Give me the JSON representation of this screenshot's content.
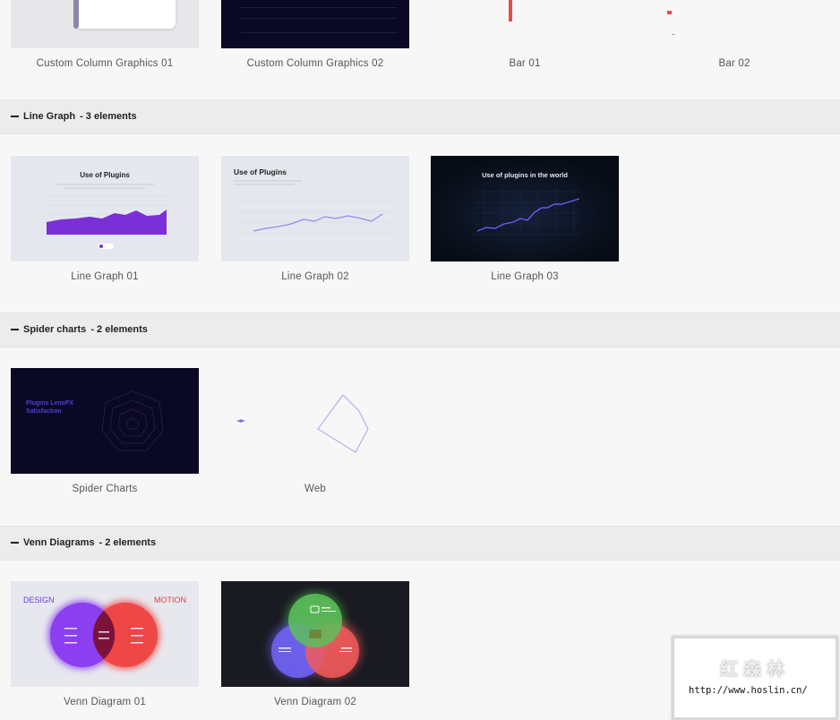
{
  "top_row": {
    "items": [
      {
        "caption": "Custom Column Graphics 01"
      },
      {
        "caption": "Custom Column Graphics 02"
      },
      {
        "caption": "Bar 01"
      },
      {
        "caption": "Bar 02"
      }
    ]
  },
  "sections": [
    {
      "title": "Line Graph",
      "count": "- 3 elements",
      "items": [
        {
          "caption": "Line Graph 01",
          "thumb_title": "Use of Plugins"
        },
        {
          "caption": "Line Graph 02",
          "thumb_title": "Use of Plugins"
        },
        {
          "caption": "Line Graph 03",
          "thumb_title": "Use of plugins in the world"
        }
      ]
    },
    {
      "title": "Spider charts",
      "count": "- 2 elements",
      "items": [
        {
          "caption": "Spider Charts",
          "thumb_title_1": "Plugins LenoFX",
          "thumb_title_2": "Satisfaction"
        },
        {
          "caption": "Web"
        }
      ]
    },
    {
      "title": "Venn Diagrams",
      "count": "- 2 elements",
      "items": [
        {
          "caption": "Venn Diagram 01",
          "left_label": "DESIGN",
          "right_label": "MOTION"
        },
        {
          "caption": "Venn Diagram 02"
        }
      ]
    }
  ],
  "watermark": {
    "text_cn": "红森林",
    "url": "http://www.hoslin.cn/"
  },
  "colors": {
    "page_bg": "#f7f7f7",
    "section_bar": "#ececec",
    "purple_accent": "#7b2fd6",
    "dark_thumb": "#0b0826"
  }
}
